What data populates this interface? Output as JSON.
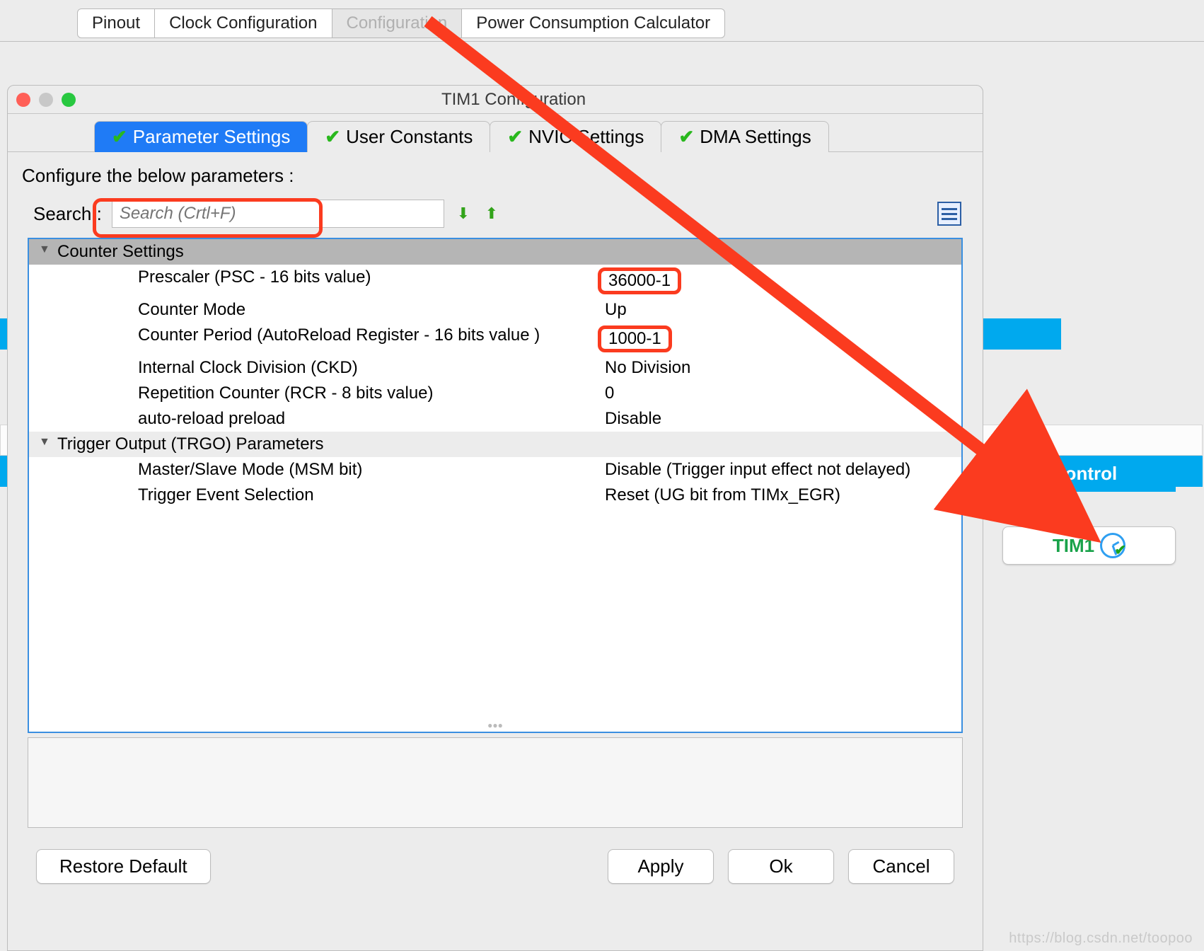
{
  "main_tabs": {
    "pinout": "Pinout",
    "clock": "Clock Configuration",
    "config": "Configuration",
    "power": "Power Consumption Calculator"
  },
  "control": {
    "header": "Control",
    "tim1": "TIM1"
  },
  "dialog": {
    "title": "TIM1 Configuration",
    "tabs": {
      "parameter": "Parameter Settings",
      "user_const": "User Constants",
      "nvic": "NVIC Settings",
      "dma": "DMA Settings"
    },
    "subtitle": "Configure the below parameters :",
    "search_label": "Search :",
    "search_placeholder": "Search (Crtl+F)"
  },
  "groups": {
    "counter": "Counter Settings",
    "trgo": "Trigger Output (TRGO) Parameters"
  },
  "params": {
    "prescaler_l": "Prescaler (PSC - 16 bits value)",
    "prescaler_v": "36000-1",
    "mode_l": "Counter Mode",
    "mode_v": "Up",
    "period_l": "Counter Period (AutoReload Register - 16 bits value )",
    "period_v": "1000-1",
    "ckd_l": "Internal Clock Division (CKD)",
    "ckd_v": "No Division",
    "rcr_l": "Repetition Counter (RCR - 8 bits value)",
    "rcr_v": "0",
    "arp_l": "auto-reload preload",
    "arp_v": "Disable",
    "msm_l": "Master/Slave Mode (MSM bit)",
    "msm_v": "Disable (Trigger input effect not delayed)",
    "trg_l": "Trigger Event Selection",
    "trg_v": "Reset (UG bit from TIMx_EGR)"
  },
  "buttons": {
    "restore": "Restore Default",
    "apply": "Apply",
    "ok": "Ok",
    "cancel": "Cancel"
  },
  "watermark": "https://blog.csdn.net/toopoo"
}
